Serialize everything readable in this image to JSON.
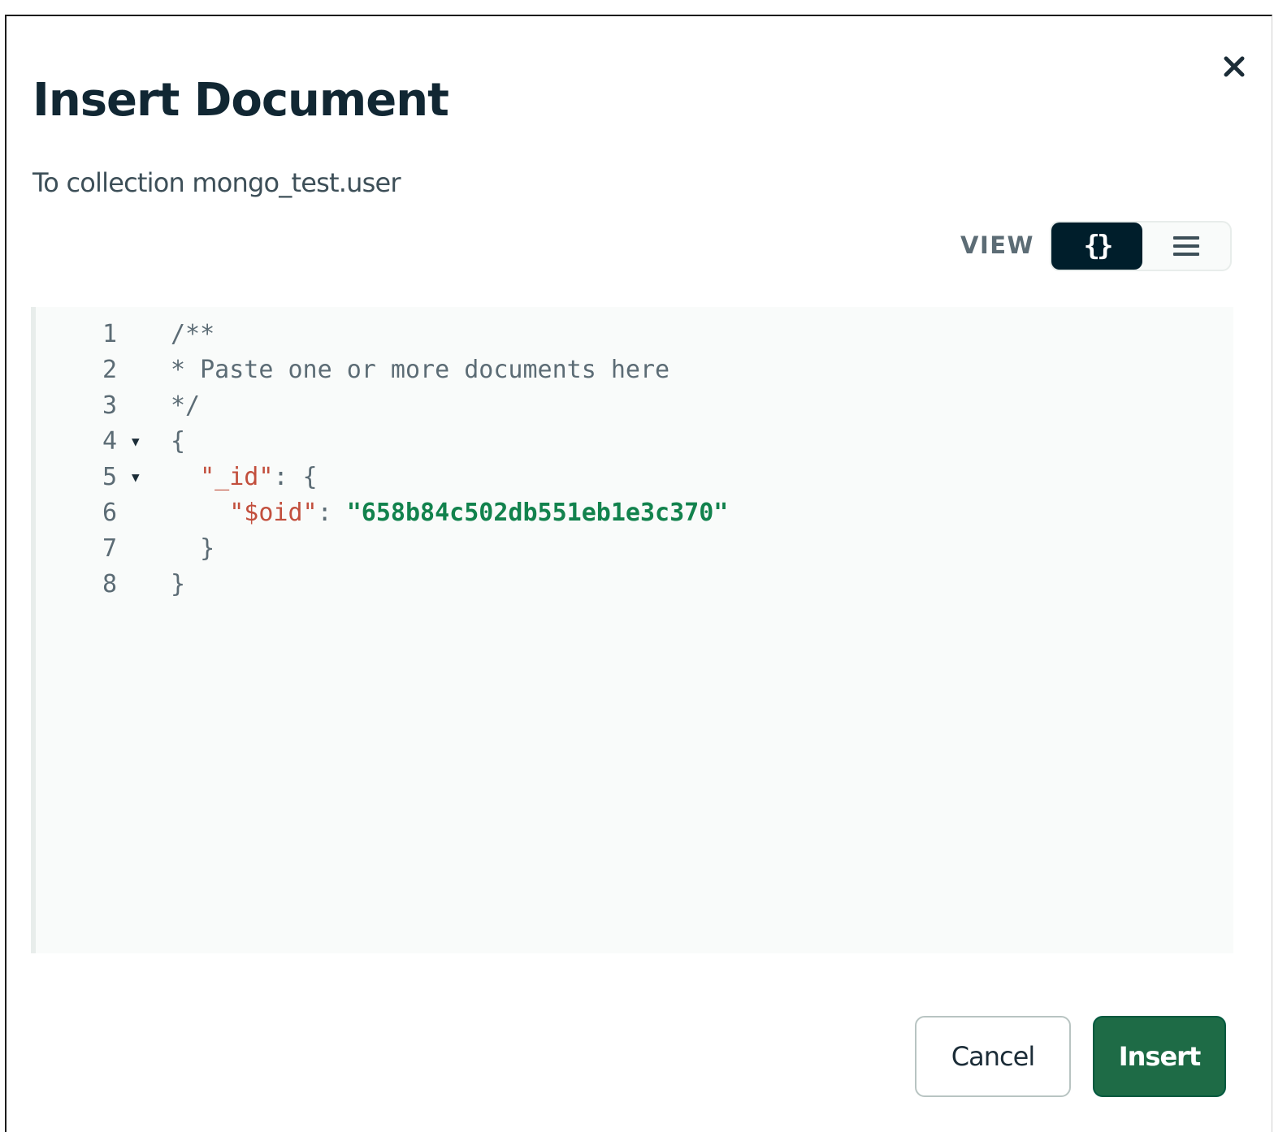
{
  "dialog": {
    "title": "Insert Document",
    "subtitle": "To collection mongo_test.user",
    "close_icon": "close-icon"
  },
  "view": {
    "label": "VIEW",
    "options": [
      {
        "name": "json",
        "label": "{}",
        "icon": "curly-braces-icon",
        "selected": true
      },
      {
        "name": "list",
        "label": "",
        "icon": "list-icon",
        "selected": false
      }
    ]
  },
  "editor": {
    "lines": [
      {
        "num": "1",
        "fold": "",
        "indent": "",
        "tokens": [
          {
            "t": "/**",
            "c": "comment"
          }
        ]
      },
      {
        "num": "2",
        "fold": "",
        "indent": "",
        "tokens": [
          {
            "t": "* Paste one or more documents here",
            "c": "comment"
          }
        ]
      },
      {
        "num": "3",
        "fold": "",
        "indent": "",
        "tokens": [
          {
            "t": "*/",
            "c": "comment"
          }
        ]
      },
      {
        "num": "4",
        "fold": "▼",
        "indent": "",
        "tokens": [
          {
            "t": "{",
            "c": "punct"
          }
        ]
      },
      {
        "num": "5",
        "fold": "▼",
        "indent": "  ",
        "tokens": [
          {
            "t": "\"_id\"",
            "c": "key"
          },
          {
            "t": ": {",
            "c": "punct"
          }
        ]
      },
      {
        "num": "6",
        "fold": "",
        "indent": "    ",
        "tokens": [
          {
            "t": "\"$oid\"",
            "c": "key"
          },
          {
            "t": ": ",
            "c": "punct"
          },
          {
            "t": "\"658b84c502db551eb1e3c370\"",
            "c": "str"
          }
        ]
      },
      {
        "num": "7",
        "fold": "",
        "indent": "  ",
        "tokens": [
          {
            "t": "}",
            "c": "punct"
          }
        ]
      },
      {
        "num": "8",
        "fold": "",
        "indent": "",
        "tokens": [
          {
            "t": "}",
            "c": "punct"
          }
        ]
      }
    ]
  },
  "footer": {
    "cancel_label": "Cancel",
    "insert_label": "Insert"
  },
  "colors": {
    "primary_button": "#1e6b46",
    "toggle_selected": "#001e2b",
    "key": "#c24f3d",
    "string": "#12824d"
  }
}
